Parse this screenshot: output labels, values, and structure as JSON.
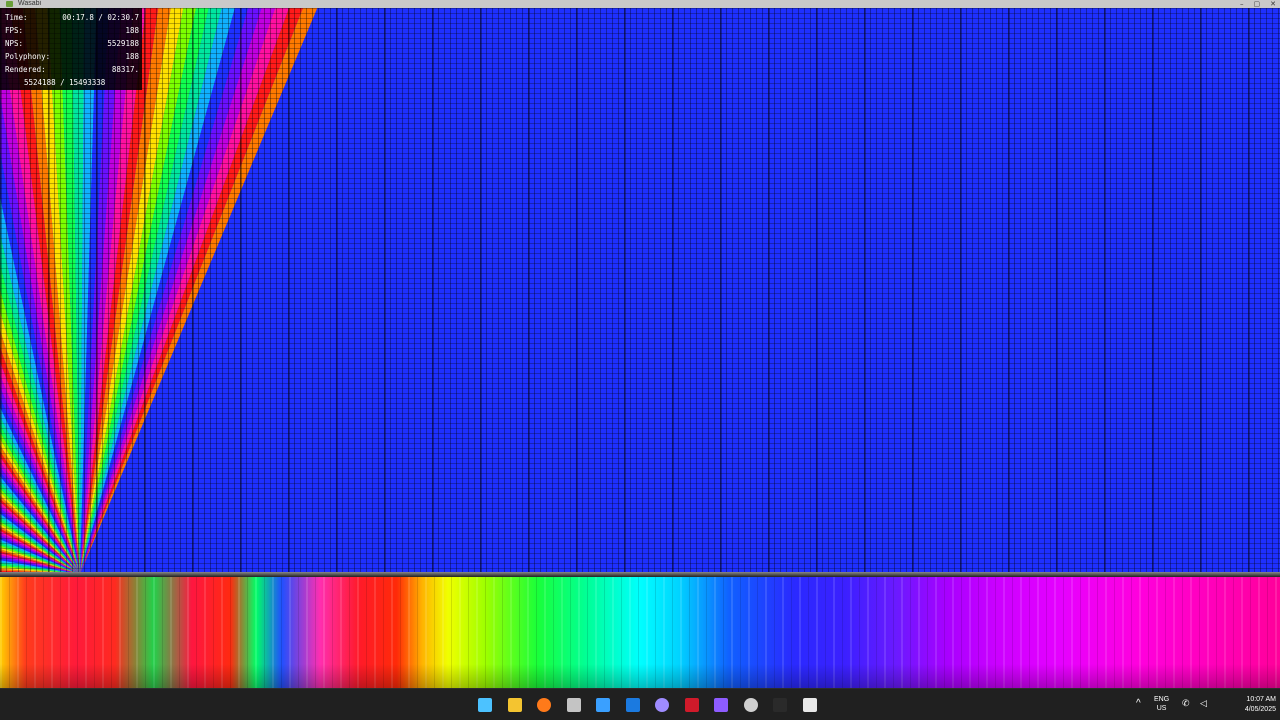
{
  "window": {
    "title": "Wasabi",
    "controls": [
      "–",
      "▢",
      "✕"
    ]
  },
  "stats": {
    "time_label": "Time:",
    "time_value": "00:17.8 / 02:30.7",
    "fps_label": "FPS:",
    "fps_value": "188",
    "nps_label": "NPS:",
    "nps_value": "5529188",
    "poly_label": "Polyphony:",
    "poly_value": "188",
    "rendered_label": "Rendered:",
    "rendered_value": "88317.",
    "notes_value": "5524188 / 15493338"
  },
  "taskbar": {
    "icons": [
      {
        "name": "windows-start-icon",
        "color": "#4cc2ff"
      },
      {
        "name": "file-explorer-icon",
        "color": "#f4c430"
      },
      {
        "name": "firefox-icon",
        "color": "#ff7a1a"
      },
      {
        "name": "microsoft-store-icon",
        "color": "#c4c4c4"
      },
      {
        "name": "app-check-icon",
        "color": "#3aa0ff"
      },
      {
        "name": "outlook-icon",
        "color": "#1b7ae0"
      },
      {
        "name": "settings-icon",
        "color": "#9f8cff"
      },
      {
        "name": "kmc-app-icon",
        "color": "#d01a2a"
      },
      {
        "name": "video-app-icon",
        "color": "#8e5cff"
      },
      {
        "name": "obs-icon",
        "color": "#cfcfcf"
      },
      {
        "name": "terminal-icon",
        "color": "#2a2a2a"
      },
      {
        "name": "wasabi-window-icon",
        "color": "#e8e8e8"
      }
    ],
    "tray": {
      "chevron": "^",
      "lang_line1": "ENG",
      "lang_line2": "US",
      "sys_icons": "✆ ◁",
      "time": "10:07 AM",
      "date": "4/05/2025"
    }
  }
}
